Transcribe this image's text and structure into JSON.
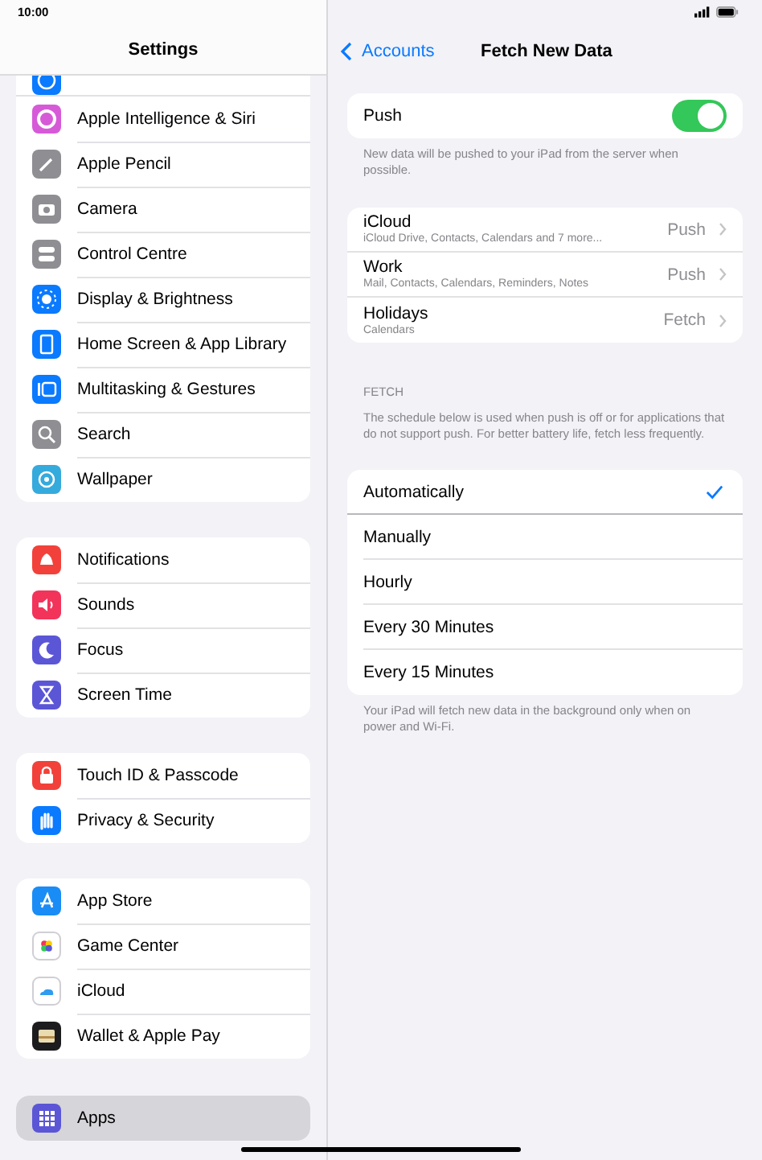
{
  "status_bar": {
    "time": "10:00"
  },
  "sidebar": {
    "title": "Settings",
    "groups": [
      {
        "items": [
          {
            "label": "Apple Intelligence & Siri",
            "color": "#d65ad8",
            "selected": false
          },
          {
            "label": "Apple Pencil",
            "color": "#8e8e93",
            "selected": false
          },
          {
            "label": "Camera",
            "color": "#8e8e93",
            "selected": false
          },
          {
            "label": "Control Centre",
            "color": "#8e8e93",
            "selected": false
          },
          {
            "label": "Display & Brightness",
            "color": "#0a7aff",
            "selected": false
          },
          {
            "label": "Home Screen & App Library",
            "color": "#0a7aff",
            "selected": false
          },
          {
            "label": "Multitasking & Gestures",
            "color": "#0a7aff",
            "selected": false
          },
          {
            "label": "Search",
            "color": "#8e8e93",
            "selected": false
          },
          {
            "label": "Wallpaper",
            "color": "#35aadc",
            "selected": false
          }
        ]
      },
      {
        "items": [
          {
            "label": "Notifications",
            "color": "#f2413a",
            "selected": false
          },
          {
            "label": "Sounds",
            "color": "#f2345a",
            "selected": false
          },
          {
            "label": "Focus",
            "color": "#5b56d6",
            "selected": false
          },
          {
            "label": "Screen Time",
            "color": "#5b56d6",
            "selected": false
          }
        ]
      },
      {
        "items": [
          {
            "label": "Touch ID & Passcode",
            "color": "#f2413a",
            "selected": false
          },
          {
            "label": "Privacy & Security",
            "color": "#0a7aff",
            "selected": false
          }
        ]
      },
      {
        "items": [
          {
            "label": "App Store",
            "color": "#1a8cf5",
            "selected": false
          },
          {
            "label": "Game Center",
            "selected": false
          },
          {
            "label": "iCloud",
            "selected": false
          },
          {
            "label": "Wallet & Apple Pay",
            "color": "#1c1c1e",
            "selected": false
          }
        ]
      }
    ],
    "bottom_items": [
      {
        "label": "Apps",
        "color": "#5b56d6",
        "selected": true
      }
    ]
  },
  "detail": {
    "back": "Accounts",
    "title": "Fetch New Data",
    "push": {
      "label": "Push",
      "on": true,
      "note": "New data will be pushed to your iPad from the server when possible."
    },
    "accounts": [
      {
        "name": "iCloud",
        "subtitle": "iCloud Drive, Contacts, Calendars and 7 more...",
        "value": "Push"
      },
      {
        "name": "Work",
        "subtitle": "Mail, Contacts, Calendars, Reminders, Notes",
        "value": "Push"
      },
      {
        "name": "Holidays",
        "subtitle": "Calendars",
        "value": "Fetch"
      }
    ],
    "fetch_header": "FETCH",
    "fetch_note": "The schedule below is used when push is off or for applications that do not support push. For better battery life, fetch less frequently.",
    "options": [
      {
        "label": "Automatically",
        "selected": true
      },
      {
        "label": "Manually",
        "selected": false
      },
      {
        "label": "Hourly",
        "selected": false
      },
      {
        "label": "Every 30 Minutes",
        "selected": false
      },
      {
        "label": "Every 15 Minutes",
        "selected": false
      }
    ],
    "footer": "Your iPad will fetch new data in the background only when on power and Wi-Fi."
  }
}
